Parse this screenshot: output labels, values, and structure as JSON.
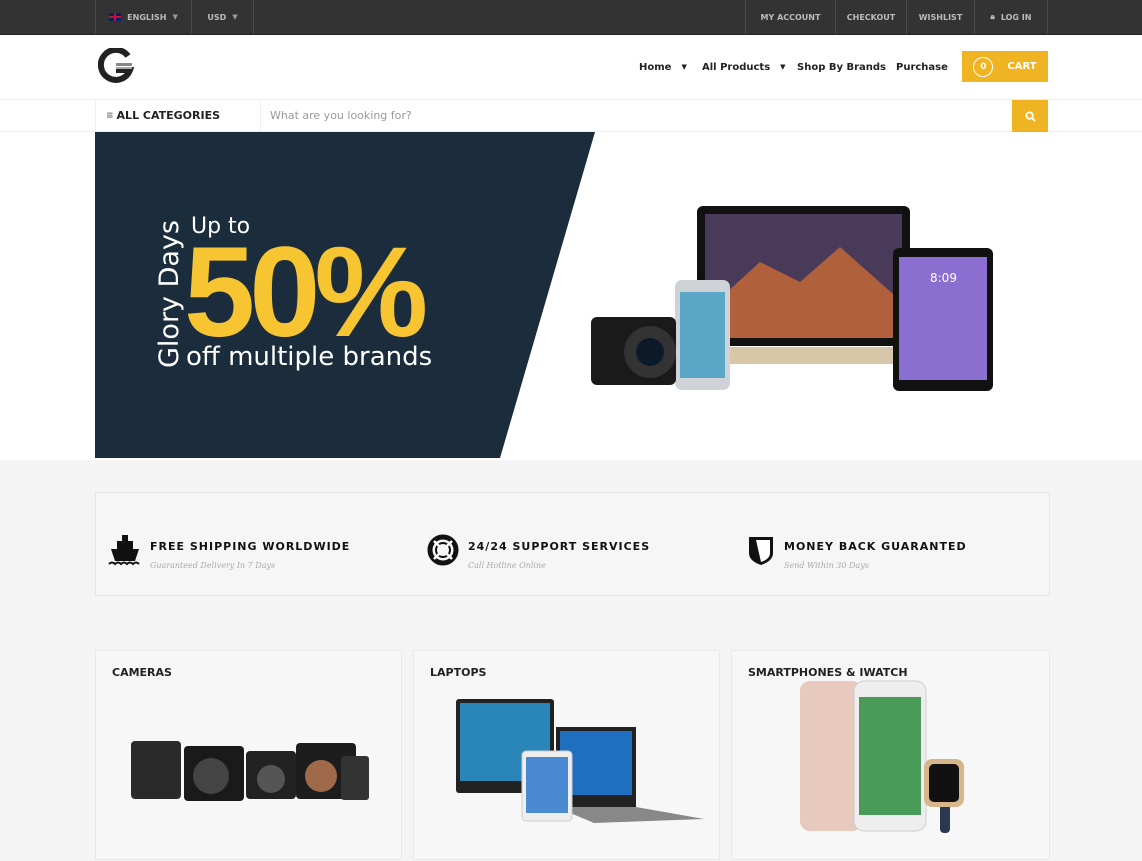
{
  "topbar": {
    "language": "ENGLISH",
    "currency": "USD",
    "links": [
      "MY ACCOUNT",
      "CHECKOUT",
      "WISHLIST",
      "LOG IN"
    ]
  },
  "header": {
    "logo": "G",
    "nav": [
      "Home",
      "All Products",
      "Shop By Brands",
      "Purchase"
    ],
    "cart_count": "0",
    "cart_label": "CART"
  },
  "search": {
    "categories_label": "ALL CATEGORIES",
    "placeholder": "What are you looking for?"
  },
  "hero": {
    "line1": "Glory Days",
    "line2": "Up to",
    "big": "50%",
    "line3": "off multiple brands",
    "colors": {
      "panel": "#1b2d3c",
      "accent": "#f7c531"
    }
  },
  "features": [
    {
      "title": "FREE SHIPPING WORLDWIDE",
      "subtitle": "Guaranteed Delivery In 7 Days",
      "icon": "ship-icon"
    },
    {
      "title": "24/24 SUPPORT SERVICES",
      "subtitle": "Call Hotline Online",
      "icon": "lifebuoy-icon"
    },
    {
      "title": "MONEY BACK GUARANTED",
      "subtitle": "Send Within 30 Days",
      "icon": "shield-icon"
    }
  ],
  "categories": [
    "CAMERAS",
    "LAPTOPS",
    "SMARTPHONES & IWATCH"
  ],
  "colors": {
    "accent": "#f0b423",
    "topbar": "#333333"
  }
}
